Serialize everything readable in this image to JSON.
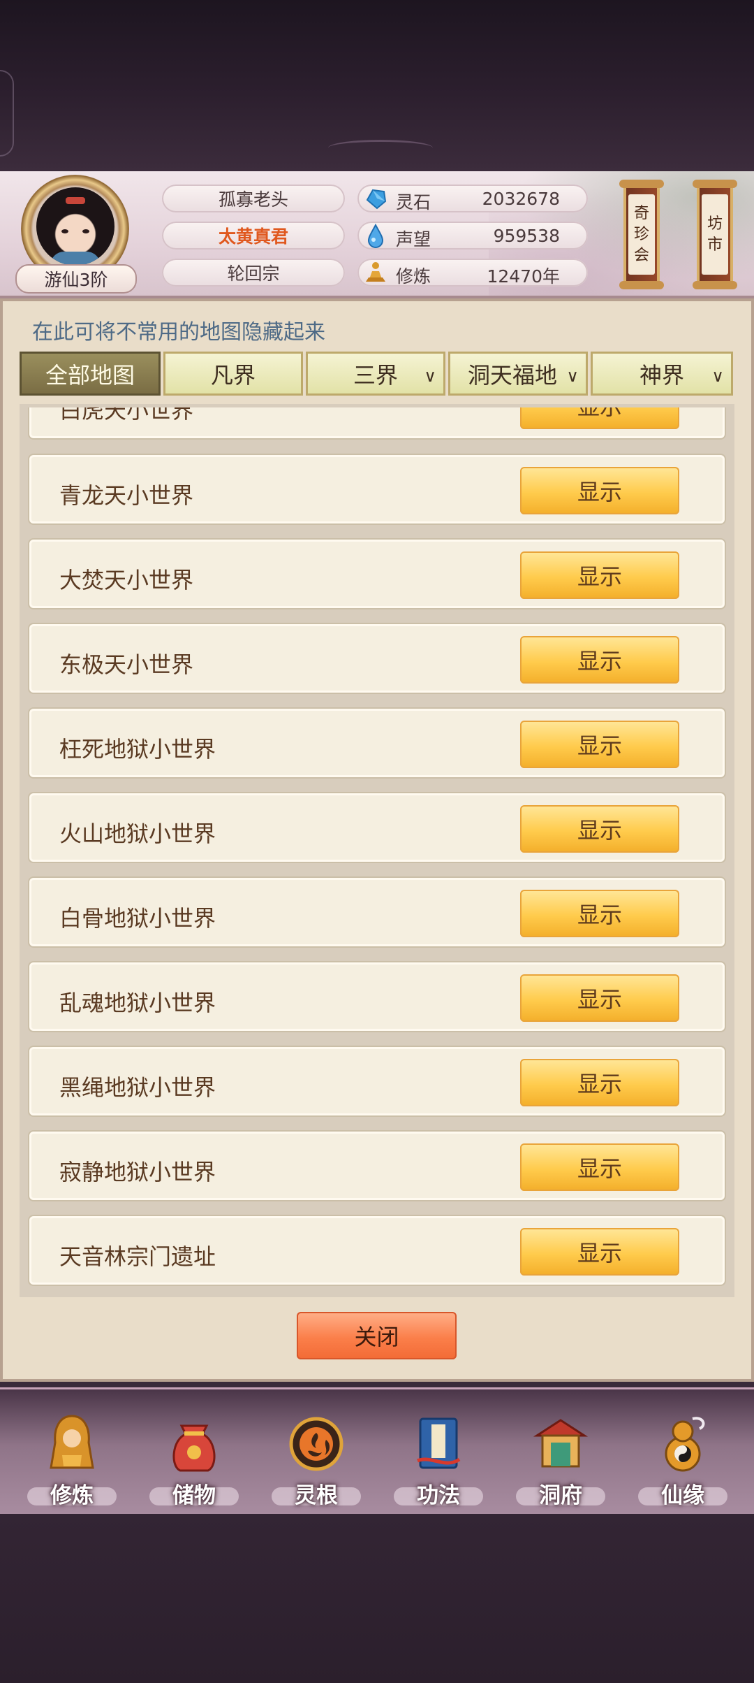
{
  "player": {
    "rank": "游仙3阶",
    "name": "孤寡老头",
    "title": "太黄真君",
    "sect": "轮回宗"
  },
  "stats": [
    {
      "icon": "spirit-stone-icon",
      "label": "灵石",
      "value": "2032678"
    },
    {
      "icon": "prestige-drop-icon",
      "label": "声望",
      "value": "959538"
    },
    {
      "icon": "meditation-icon",
      "label": "修炼",
      "value": "12470年"
    }
  ],
  "shops": {
    "treasure": [
      "奇",
      "珍",
      "会"
    ],
    "market": [
      "坊",
      "市"
    ]
  },
  "panel": {
    "hint": "在此可将不常用的地图隐藏起来",
    "tabs": [
      {
        "label": "全部地图",
        "active": true,
        "dropdown": false
      },
      {
        "label": "凡界",
        "active": false,
        "dropdown": false
      },
      {
        "label": "三界",
        "active": false,
        "dropdown": true
      },
      {
        "label": "洞天福地",
        "active": false,
        "dropdown": true
      },
      {
        "label": "神界",
        "active": false,
        "dropdown": true
      }
    ],
    "rows": [
      {
        "label": "白虎天小世界",
        "button": "显示"
      },
      {
        "label": "青龙天小世界",
        "button": "显示"
      },
      {
        "label": "大焚天小世界",
        "button": "显示"
      },
      {
        "label": "东极天小世界",
        "button": "显示"
      },
      {
        "label": "枉死地狱小世界",
        "button": "显示"
      },
      {
        "label": "火山地狱小世界",
        "button": "显示"
      },
      {
        "label": "白骨地狱小世界",
        "button": "显示"
      },
      {
        "label": "乱魂地狱小世界",
        "button": "显示"
      },
      {
        "label": "黑绳地狱小世界",
        "button": "显示"
      },
      {
        "label": "寂静地狱小世界",
        "button": "显示"
      },
      {
        "label": "天音林宗门遗址",
        "button": "显示"
      }
    ],
    "close": "关闭"
  },
  "nav": [
    {
      "label": "修炼",
      "icon": "cultivate-icon"
    },
    {
      "label": "储物",
      "icon": "storage-bag-icon"
    },
    {
      "label": "灵根",
      "icon": "spirit-root-icon"
    },
    {
      "label": "功法",
      "icon": "technique-book-icon"
    },
    {
      "label": "洞府",
      "icon": "cave-dwelling-icon"
    },
    {
      "label": "仙缘",
      "icon": "immortal-fate-icon"
    }
  ],
  "colors": {
    "button_gold": "#ffcb4c",
    "close_orange": "#fb7f4a",
    "title_orange": "#e0581e",
    "hint_blue": "#4e6a86"
  }
}
